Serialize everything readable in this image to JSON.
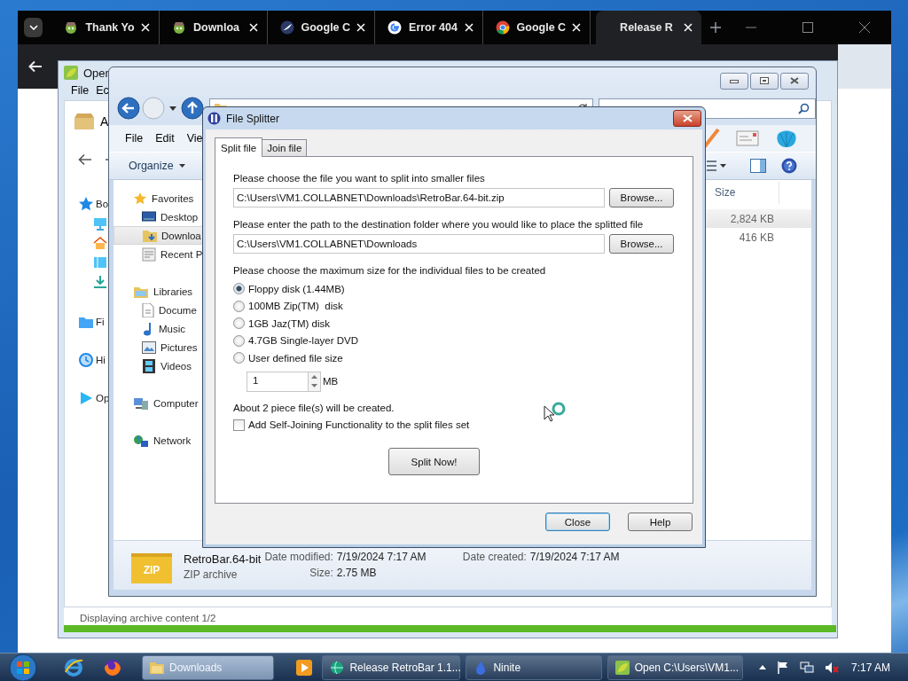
{
  "browser": {
    "tabs": [
      {
        "label": "Thank Yo",
        "selected": false
      },
      {
        "label": "Downloa",
        "selected": false
      },
      {
        "label": "Google C",
        "selected": false
      },
      {
        "label": "Error 404",
        "selected": false
      },
      {
        "label": "Google C",
        "selected": false
      },
      {
        "label": "Release R",
        "selected": true
      }
    ]
  },
  "archive_window": {
    "title": "Open",
    "menu": [
      "File",
      "Ec"
    ],
    "header": "A",
    "nav": [
      {
        "label": "Bo"
      },
      {
        "label": "Fi"
      },
      {
        "label": "Hi"
      },
      {
        "label": "Op"
      }
    ],
    "status": "Displaying archive content 1/2",
    "progress": {
      "level": 1
    }
  },
  "explorer": {
    "menu": [
      "File",
      "Edit",
      "Vie"
    ],
    "organize": "Organize",
    "nav": [
      {
        "label": "Favorites",
        "selected": false,
        "children": [
          {
            "label": "Desktop",
            "selected": false
          },
          {
            "label": "Downloa",
            "selected": true
          },
          {
            "label": "Recent P",
            "selected": false
          }
        ]
      },
      {
        "label": "Libraries",
        "selected": false,
        "children": [
          {
            "label": "Docume",
            "selected": false
          },
          {
            "label": "Music",
            "selected": false
          },
          {
            "label": "Pictures",
            "selected": false
          },
          {
            "label": "Videos",
            "selected": false
          }
        ]
      },
      {
        "label": "Computer",
        "selected": false
      },
      {
        "label": "Network",
        "selected": false
      }
    ],
    "columns": [
      "Size"
    ],
    "rows": [
      {
        "size": "2,824 KB",
        "selected": true
      },
      {
        "size": "416 KB",
        "selected": false
      }
    ],
    "details": {
      "name": "RetroBar.64-bit",
      "type": "ZIP archive",
      "icon_label": "ZIP",
      "fields": [
        {
          "label": "Date modified:",
          "value": "7/19/2024 7:17 AM"
        },
        {
          "label": "Date created:",
          "value": "7/19/2024 7:17 AM"
        },
        {
          "label": "Size:",
          "value": "2.75 MB"
        }
      ]
    }
  },
  "dialog": {
    "title": "File Splitter",
    "tabs": [
      {
        "label": "Split file",
        "selected": true
      },
      {
        "label": "Join file",
        "selected": false
      }
    ],
    "source": {
      "label": "Please choose the file you want to split into smaller files",
      "value": "C:\\Users\\VM1.COLLABNET\\Downloads\\RetroBar.64-bit.zip",
      "button": "Browse..."
    },
    "destination": {
      "label": "Please enter the path to the destination folder where you would like to place the splitted file",
      "value": "C:\\Users\\VM1.COLLABNET\\Downloads",
      "button": "Browse..."
    },
    "size_prompt": "Please choose the maximum size for the individual files to be created",
    "size_options": [
      {
        "label": "Floppy disk (1.44MB)",
        "selected": true
      },
      {
        "label": "100MB Zip(TM)  disk",
        "selected": false
      },
      {
        "label": "1GB Jaz(TM) disk",
        "selected": false
      },
      {
        "label": "4.7GB Single-layer DVD",
        "selected": false
      },
      {
        "label": "User defined file size",
        "selected": false
      }
    ],
    "custom_size": {
      "value": "1",
      "unit": "MB"
    },
    "estimate": "About 2 piece file(s) will be created.",
    "self_joining": {
      "label": "Add Self-Joining Functionality to the split files set",
      "checked": false
    },
    "split_button": "Split Now!",
    "buttons": [
      {
        "label": "Close",
        "default": true
      },
      {
        "label": "Help",
        "default": false
      }
    ]
  },
  "taskbar": {
    "buttons": [
      {
        "label": "Downloads",
        "selected": true
      },
      {
        "label": "Release RetroBar 1.1...",
        "selected": false
      },
      {
        "label": "Ninite",
        "selected": false
      },
      {
        "label": "Open C:\\Users\\VM1...",
        "selected": false
      }
    ],
    "clock": "7:17 AM"
  }
}
